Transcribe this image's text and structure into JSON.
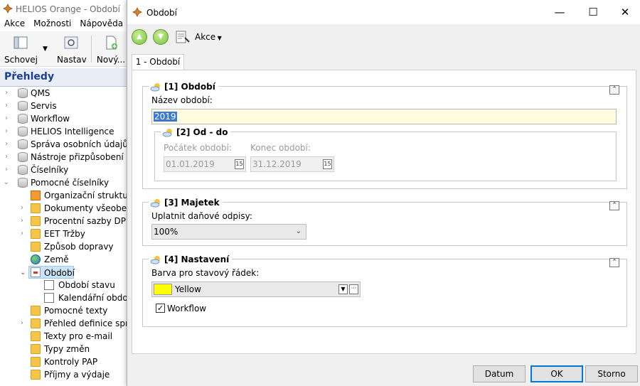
{
  "main": {
    "title": "HELIOS Orange - Období",
    "menu": [
      "Akce",
      "Možnosti",
      "Nápověda"
    ],
    "toolbar": {
      "hide_label": "Schovej",
      "settings_label": "Nastav",
      "new_label": "Nový..."
    },
    "overview_title": "Přehledy",
    "tree": [
      {
        "label": "QMS"
      },
      {
        "label": "Servis"
      },
      {
        "label": "Workflow"
      },
      {
        "label": "HELIOS Intelligence"
      },
      {
        "label": "Správa osobních údajů"
      },
      {
        "label": "Nástroje přizpůsobení"
      },
      {
        "label": "Číselníky"
      },
      {
        "label": "Pomocné číselníky"
      },
      {
        "label": "Organizační struktura"
      },
      {
        "label": "Dokumenty všeobecn"
      },
      {
        "label": "Procentní sazby DPH"
      },
      {
        "label": "EET Tržby"
      },
      {
        "label": "Způsob dopravy"
      },
      {
        "label": "Země"
      },
      {
        "label": "Období"
      },
      {
        "label": "Období stavu"
      },
      {
        "label": "Kalendářní období"
      },
      {
        "label": "Pomocné texty"
      },
      {
        "label": "Přehled definice správ"
      },
      {
        "label": "Texty pro e-mail"
      },
      {
        "label": "Typy změn"
      },
      {
        "label": "Kontroly PAP"
      },
      {
        "label": "Příjmy a výdaje"
      }
    ]
  },
  "dialog": {
    "title": "Období",
    "actions_label": "Akce",
    "tab_label": "1 - Období",
    "group1": {
      "title": "[1] Období",
      "name_label": "Název období:",
      "name_value": "2019",
      "subgroup": {
        "title": "[2] Od - do",
        "start_label": "Počátek období:",
        "start_value": "01.01.2019",
        "end_label": "Konec období:",
        "end_value": "31.12.2019"
      }
    },
    "group3": {
      "title": "[3] Majetek",
      "tax_label": "Uplatnit daňové odpisy:",
      "tax_value": "100%"
    },
    "group4": {
      "title": "[4] Nastavení",
      "color_label": "Barva pro stavový řádek:",
      "color_value": "Yellow",
      "color_hex": "#ffff00",
      "workflow_label": "Workflow",
      "workflow_checked": true
    },
    "buttons": {
      "date": "Datum",
      "ok": "OK",
      "cancel": "Storno"
    }
  }
}
